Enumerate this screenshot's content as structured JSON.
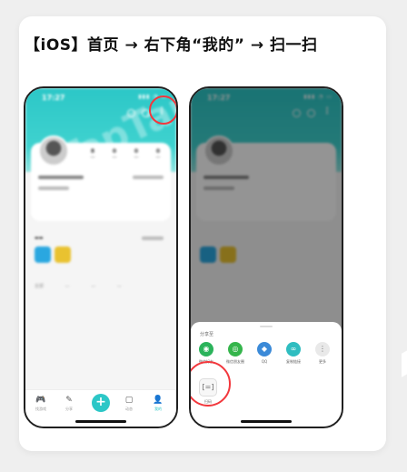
{
  "page": {
    "title": "【iOS】首页 → 右下角“我的” → 扫一扫"
  },
  "left_phone": {
    "status_time": "17:27",
    "status_icons": "▮▮▮ ◔ ▭",
    "more_icon": "⋮",
    "watermark": "TapTap",
    "profile": {
      "stats": [
        {
          "value": "8",
          "label": "—"
        },
        {
          "value": "0",
          "label": "—"
        },
        {
          "value": "0",
          "label": "—"
        },
        {
          "value": "0",
          "label": "—"
        }
      ]
    },
    "tabs": [
      "全部",
      "—",
      "—",
      "—"
    ],
    "bottom_nav": [
      {
        "icon": "🎮",
        "label": "找游戏"
      },
      {
        "icon": "✎",
        "label": "分享"
      },
      {
        "icon": "+",
        "label": ""
      },
      {
        "icon": "▢",
        "label": "动态"
      },
      {
        "icon": "👤",
        "label": "我的"
      }
    ]
  },
  "right_phone": {
    "status_time": "17:27",
    "status_icons": "▮▮▮ ◔ ▭",
    "sheet": {
      "title": "分享至",
      "items": [
        {
          "label": "微信好友",
          "color": "#2bb35b",
          "icon": "◉"
        },
        {
          "label": "微信朋友圈",
          "color": "#35b54c",
          "icon": "◎"
        },
        {
          "label": "QQ",
          "color": "#3b8ad8",
          "icon": "◆"
        },
        {
          "label": "复制链接",
          "color": "#2fbdc0",
          "icon": "∞"
        },
        {
          "label": "更多",
          "color": "#e9e9e9",
          "icon": "⋮"
        }
      ],
      "scan": {
        "label": "扫码",
        "icon": "[=]"
      }
    }
  },
  "colors": {
    "accent": "#2cc7c7",
    "highlight": "#f2383d"
  }
}
